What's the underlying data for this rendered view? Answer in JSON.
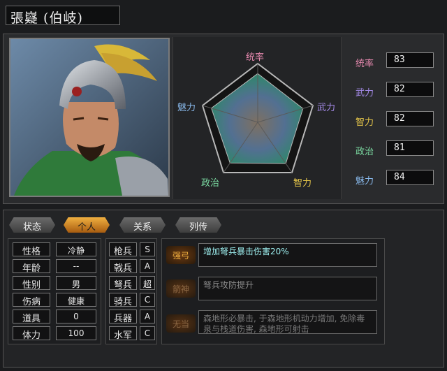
{
  "character": {
    "name": "張嶷 (伯岐)"
  },
  "radar": {
    "labels": {
      "top": "统率",
      "right": "武力",
      "bottom_right": "智力",
      "bottom_left": "政治",
      "left": "魅力"
    }
  },
  "stats": [
    {
      "label": "统率",
      "value": "83",
      "color": "#e88ab0"
    },
    {
      "label": "武力",
      "value": "82",
      "color": "#a48ae8"
    },
    {
      "label": "智力",
      "value": "82",
      "color": "#e8c84a"
    },
    {
      "label": "政治",
      "value": "81",
      "color": "#7ad8a0"
    },
    {
      "label": "魅力",
      "value": "84",
      "color": "#88b8ea"
    }
  ],
  "tabs": [
    {
      "label": "状态",
      "active": false
    },
    {
      "label": "个人",
      "active": true
    },
    {
      "label": "关系",
      "active": false
    },
    {
      "label": "列传",
      "active": false
    }
  ],
  "personal": [
    {
      "label": "性格",
      "value": "冷静"
    },
    {
      "label": "年龄",
      "value": "--"
    },
    {
      "label": "性别",
      "value": "男"
    },
    {
      "label": "伤病",
      "value": "健康"
    },
    {
      "label": "道具",
      "value": "0"
    },
    {
      "label": "体力",
      "value": "100"
    }
  ],
  "aptitudes": [
    {
      "label": "枪兵",
      "value": "S"
    },
    {
      "label": "戟兵",
      "value": "A"
    },
    {
      "label": "弩兵",
      "value": "超"
    },
    {
      "label": "骑兵",
      "value": "C"
    },
    {
      "label": "兵器",
      "value": "A"
    },
    {
      "label": "水军",
      "value": "C"
    }
  ],
  "skills": [
    {
      "name": "强弓",
      "desc": "增加弩兵暴击伤害20%",
      "active": true
    },
    {
      "name": "箭神",
      "desc": "弩兵攻防提升",
      "active": false
    },
    {
      "name": "无当",
      "desc": "森地形必暴击, 于森地形机动力增加, 免除毒泉与栈道伤害, 森地形可射击",
      "active": false
    }
  ],
  "colors": {
    "active_tab": "#f0b040",
    "active_skill_text": "#9ef0f0",
    "inactive_skill_text": "#8a8a8a"
  }
}
